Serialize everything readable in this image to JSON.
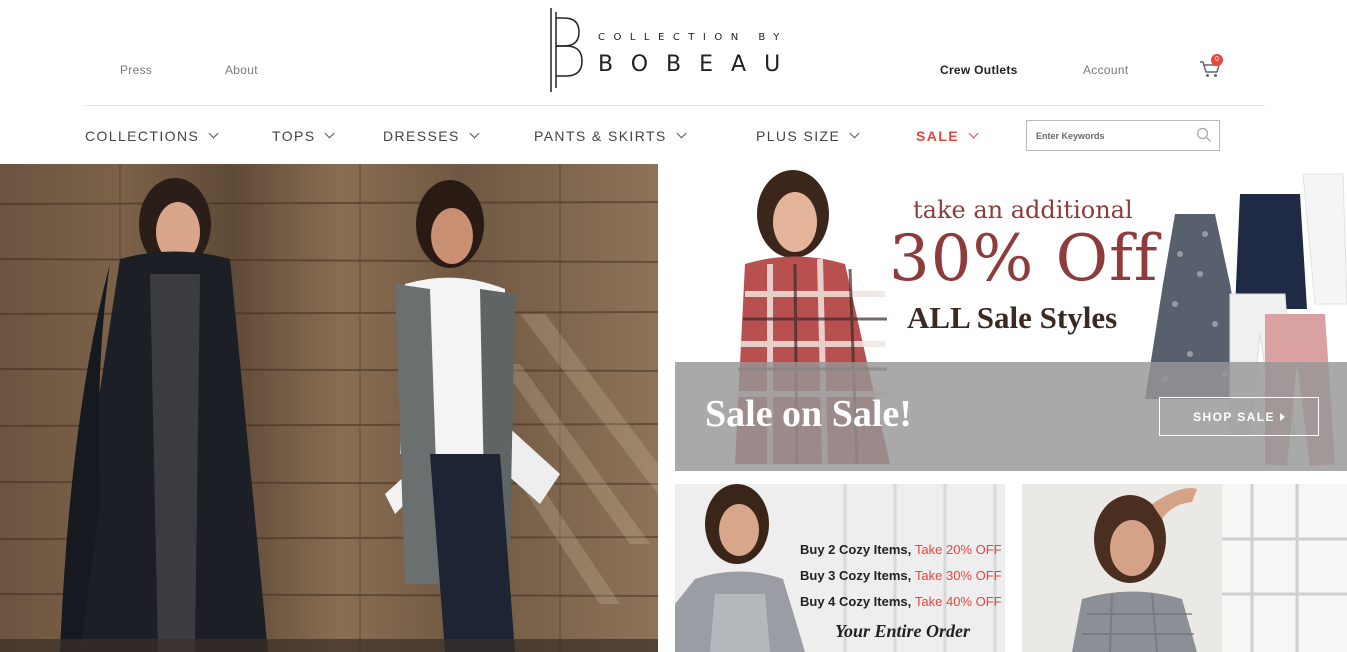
{
  "header": {
    "links": {
      "press": "Press",
      "about": "About",
      "crew_outlets": "Crew Outlets",
      "account": "Account"
    },
    "logo": {
      "small_text": "COLLECTION BY",
      "brand_text": "BOBEAU"
    },
    "cart": {
      "count": "0",
      "icon": "cart-icon"
    }
  },
  "nav": {
    "items": [
      {
        "label": "COLLECTIONS"
      },
      {
        "label": "TOPS"
      },
      {
        "label": "DRESSES"
      },
      {
        "label": "PANTS & SKIRTS"
      },
      {
        "label": "PLUS SIZE"
      },
      {
        "label": "SALE"
      }
    ],
    "search": {
      "placeholder": "Enter Keywords",
      "icon": "search-icon"
    }
  },
  "promo": {
    "line1": "take an additional",
    "line2": "30% Off",
    "line3": "ALL Sale Styles",
    "band_title": "Sale on Sale!",
    "button_label": "SHOP SALE"
  },
  "cozy": {
    "rows": [
      {
        "lead": "Buy 2 Cozy Items,",
        "offer": "Take 20% OFF"
      },
      {
        "lead": "Buy 3 Cozy Items,",
        "offer": "Take 30% OFF"
      },
      {
        "lead": "Buy 4 Cozy Items,",
        "offer": "Take 40% OFF"
      }
    ],
    "footer": "Your Entire Order"
  },
  "colors": {
    "accent_red": "#e2473f",
    "promo_burgundy": "#8e3b3b",
    "band_gray": "#969696"
  }
}
